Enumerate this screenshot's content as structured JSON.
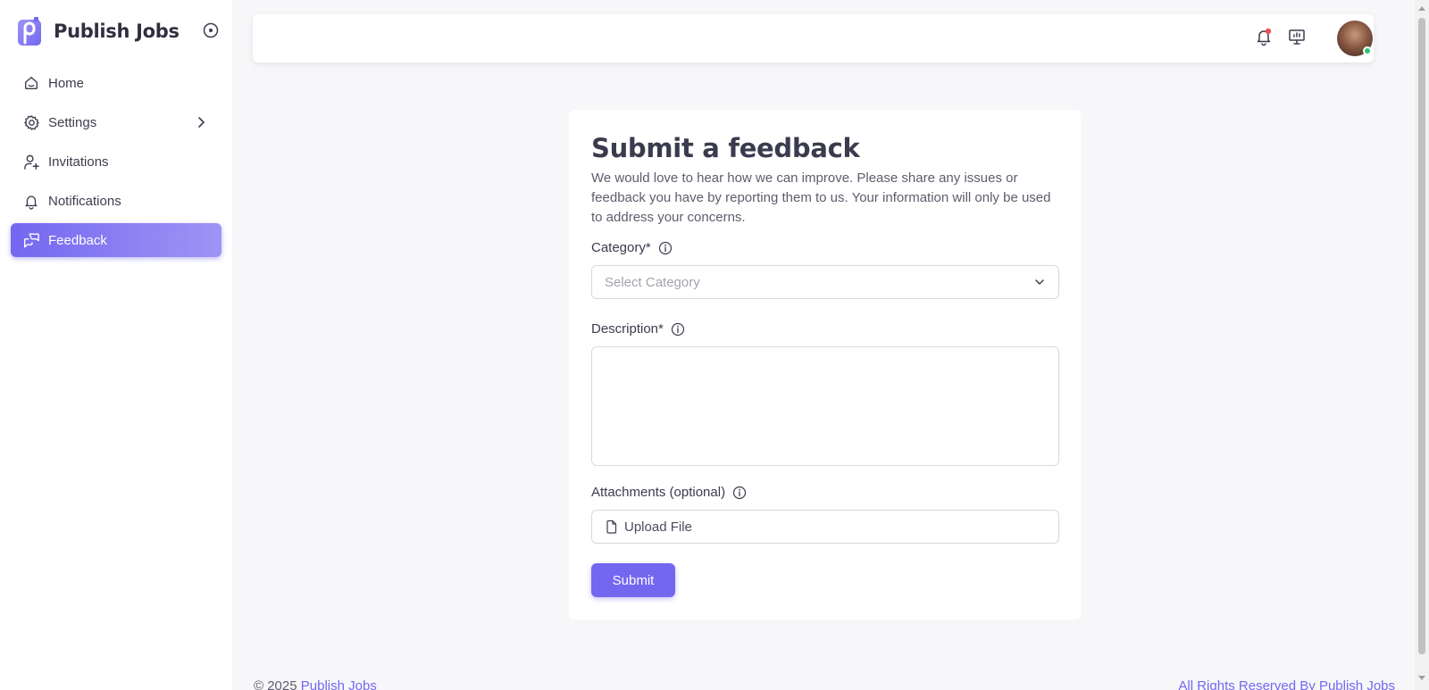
{
  "app": {
    "name": "Publish Jobs"
  },
  "sidebar": {
    "items": [
      {
        "label": "Home",
        "icon": "home-icon",
        "active": false
      },
      {
        "label": "Settings",
        "icon": "gear-icon",
        "active": false,
        "has_submenu": true
      },
      {
        "label": "Invitations",
        "icon": "user-plus-icon",
        "active": false
      },
      {
        "label": "Notifications",
        "icon": "bell-icon",
        "active": false
      },
      {
        "label": "Feedback",
        "icon": "messages-icon",
        "active": true
      }
    ]
  },
  "topbar": {
    "icons": [
      "bell-icon",
      "presentation-icon",
      "avatar"
    ],
    "notification_dot_color": "#ea5455",
    "online_status_color": "#28c76f"
  },
  "form": {
    "title": "Submit a feedback",
    "description": "We would love to hear how we can improve. Please share any issues or feedback you have by reporting them to us. Your information will only be used to address your concerns.",
    "category": {
      "label": "Category*",
      "placeholder": "Select Category"
    },
    "description_field": {
      "label": "Description*",
      "value": ""
    },
    "attachments": {
      "label": "Attachments (optional)",
      "button_label": "Upload File"
    },
    "submit_label": "Submit"
  },
  "footer": {
    "copyright_prefix": "© 2025 ",
    "brand_link": "Publish Jobs",
    "rights": "All Rights Reserved By Publish Jobs"
  },
  "colors": {
    "accent": "#7367f0",
    "background": "#f7f7f9",
    "surface": "#ffffff"
  }
}
